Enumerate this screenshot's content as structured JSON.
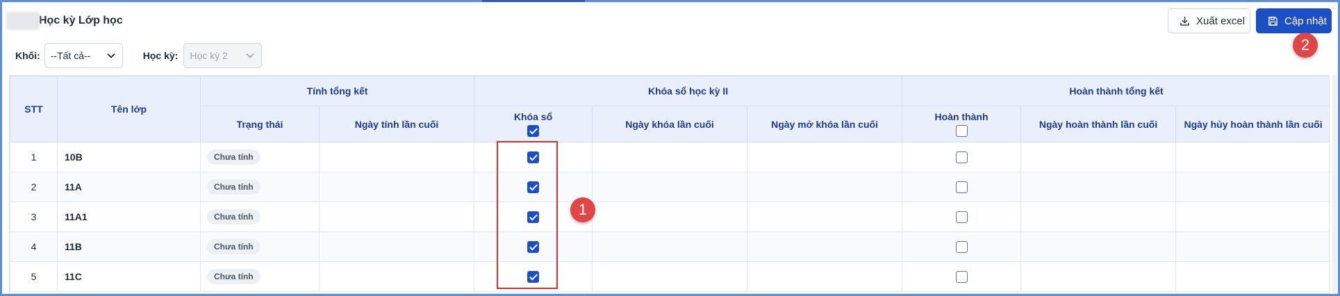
{
  "header": {
    "title": "Học kỳ Lớp học",
    "export_label": "Xuất excel",
    "update_label": "Cập nhật"
  },
  "filters": {
    "grade_label": "Khối:",
    "grade_value": "--Tất cả--",
    "semester_label": "Học kỳ:",
    "semester_value": "Học kỳ 2"
  },
  "table": {
    "col_stt": "STT",
    "col_class": "Tên lớp",
    "group_calc": "Tính tổng kết",
    "group_lock": "Khóa sổ học kỳ II",
    "group_done": "Hoàn thành tổng kết",
    "col_status": "Trạng thái",
    "col_last_calc": "Ngày tính lần cuối",
    "col_lock": "Khóa sổ",
    "col_last_lock": "Ngày khóa lần cuối",
    "col_last_unlock": "Ngày mở khóa lần cuối",
    "col_done": "Hoàn thành",
    "col_last_done": "Ngày hoàn thành lần cuối",
    "col_last_cancel": "Ngày hủy hoàn thành lần cuối",
    "header_lock_all_checked": true,
    "header_done_all_checked": false,
    "rows": [
      {
        "stt": "1",
        "name": "10B",
        "status": "Chưa tính",
        "locked": true,
        "done": false
      },
      {
        "stt": "2",
        "name": "11A",
        "status": "Chưa tính",
        "locked": true,
        "done": false
      },
      {
        "stt": "3",
        "name": "11A1",
        "status": "Chưa tính",
        "locked": true,
        "done": false
      },
      {
        "stt": "4",
        "name": "11B",
        "status": "Chưa tính",
        "locked": true,
        "done": false
      },
      {
        "stt": "5",
        "name": "11C",
        "status": "Chưa tính",
        "locked": true,
        "done": false
      }
    ]
  },
  "annotations": {
    "marker_1": "1",
    "marker_2": "2",
    "accent_color": "#1d4fc4",
    "marker_color": "#e04646"
  }
}
